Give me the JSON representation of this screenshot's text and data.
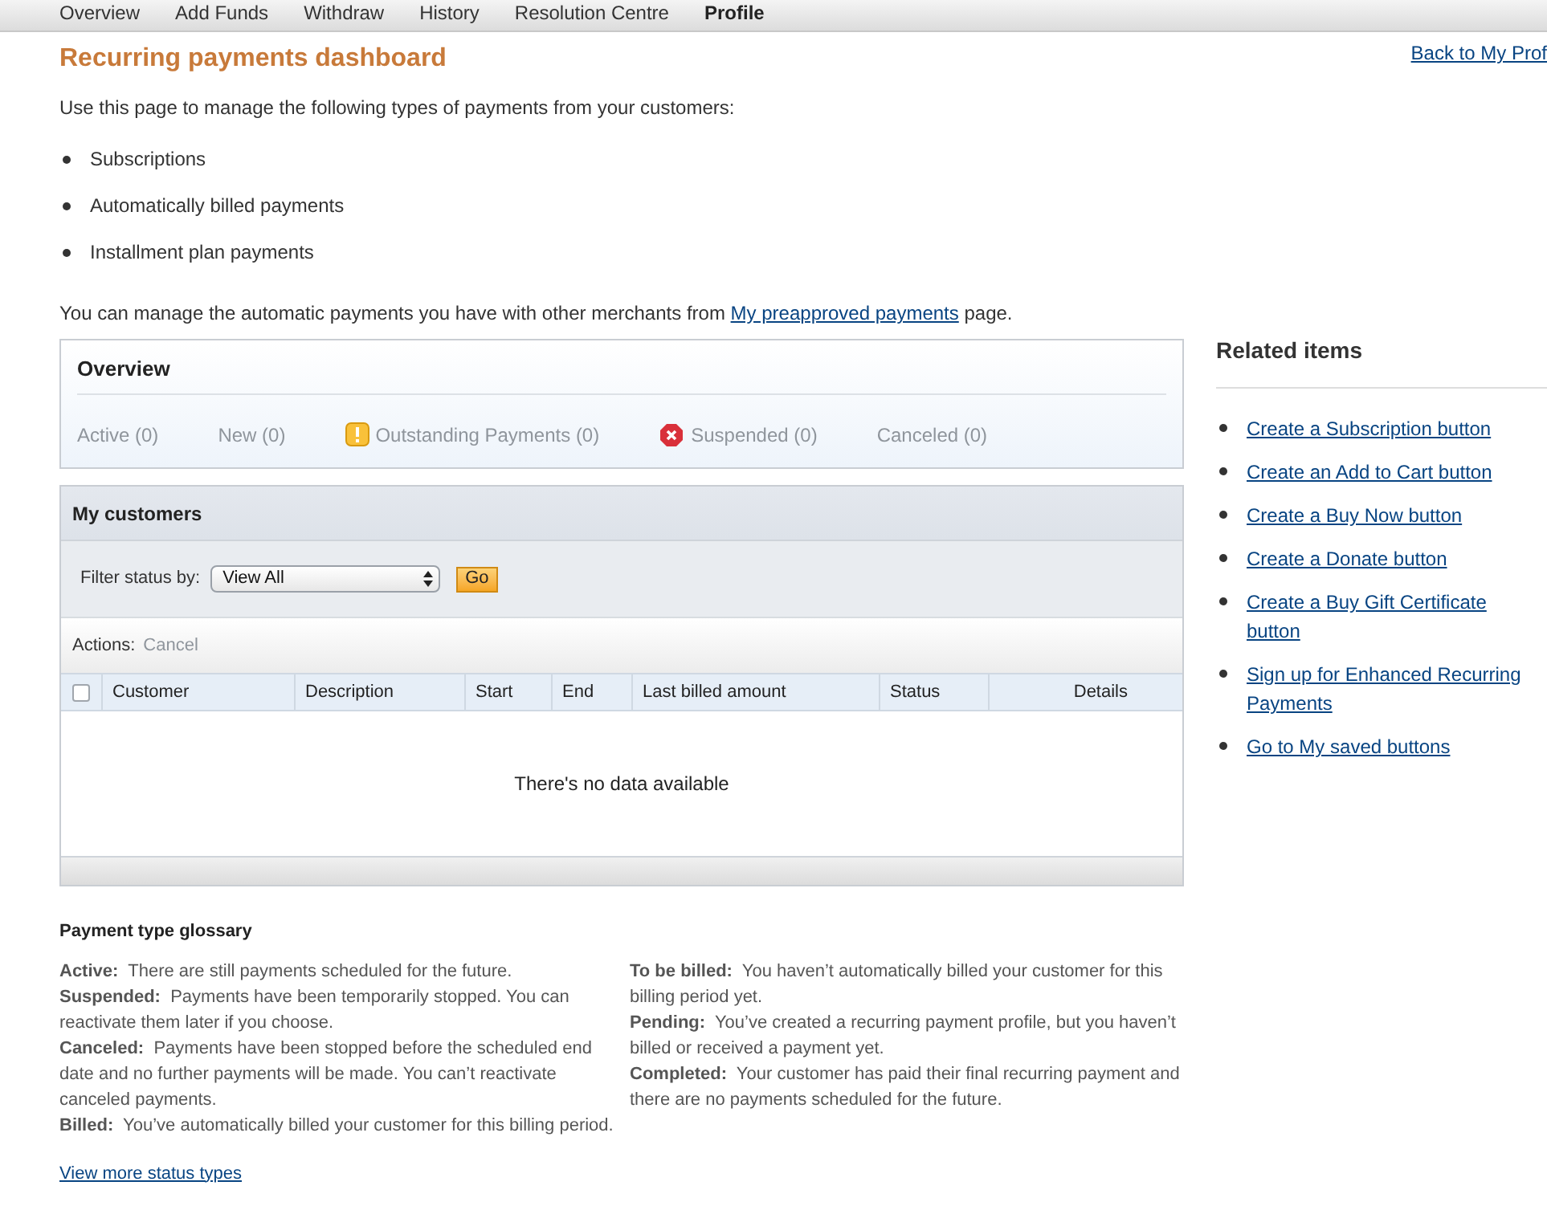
{
  "nav_tabs": [
    {
      "label": "Overview",
      "selected": false
    },
    {
      "label": "Add Funds",
      "selected": false
    },
    {
      "label": "Withdraw",
      "selected": false
    },
    {
      "label": "History",
      "selected": false
    },
    {
      "label": "Resolution Centre",
      "selected": false
    },
    {
      "label": "Profile",
      "selected": true
    }
  ],
  "title": "Recurring payments dashboard",
  "back_link": "Back to My Prof",
  "intro": "Use this page to manage the following types of payments from your customers:",
  "payment_types": [
    "Subscriptions",
    "Automatically billed payments",
    "Installment plan payments"
  ],
  "manage_text": {
    "before": "You can manage the automatic payments you have with other merchants from",
    "link": "My preapproved payments",
    "after": "page."
  },
  "overview": {
    "title": "Overview",
    "statuses": [
      {
        "label": "Active (0)",
        "kind": "plain"
      },
      {
        "label": "New (0)",
        "kind": "plain"
      },
      {
        "label": "Outstanding Payments (0)",
        "kind": "warning"
      },
      {
        "label": "Suspended (0)",
        "kind": "error"
      },
      {
        "label": "Canceled (0)",
        "kind": "plain"
      }
    ]
  },
  "customers": {
    "title": "My customers",
    "filter_label": "Filter status by:",
    "filter_value": "View All",
    "go": "Go",
    "actions_label": "Actions:",
    "action_cancel": {
      "label": "Cancel",
      "disabled": true
    },
    "columns": [
      "Customer",
      "Description",
      "Start",
      "End",
      "Last billed amount",
      "Status",
      "Details"
    ],
    "select_all_checked": false,
    "empty": "There's no data available"
  },
  "glossary": {
    "title": "Payment type glossary",
    "left": [
      {
        "term": "Active:",
        "text": "There are still payments scheduled for the future."
      },
      {
        "term": "Suspended:",
        "text": "Payments have been temporarily stopped. You can reactivate them later if you choose."
      },
      {
        "term": "Canceled:",
        "text": "Payments have been stopped before the scheduled end date and no further payments will be made. You can’t reactivate canceled payments."
      },
      {
        "term": "Billed:",
        "text": "You’ve automatically billed your customer for this billing period."
      }
    ],
    "right": [
      {
        "term": "To be billed:",
        "text": "You haven’t automatically billed your customer for this billing period yet."
      },
      {
        "term": "Pending:",
        "text": "You’ve created a recurring payment profile, but you haven’t billed or received a payment yet."
      },
      {
        "term": "Completed:",
        "text": "Your customer has paid their final recurring payment and there are no payments scheduled for the future."
      }
    ],
    "more_link": "View more status types"
  },
  "related": {
    "title": "Related items",
    "links": [
      "Create a Subscription button",
      "Create an Add to Cart button",
      "Create a Buy Now button",
      "Create a Donate button",
      "Create a Buy Gift Certificate button",
      "Sign up for Enhanced Recurring Payments",
      "Go to My saved buttons"
    ]
  }
}
